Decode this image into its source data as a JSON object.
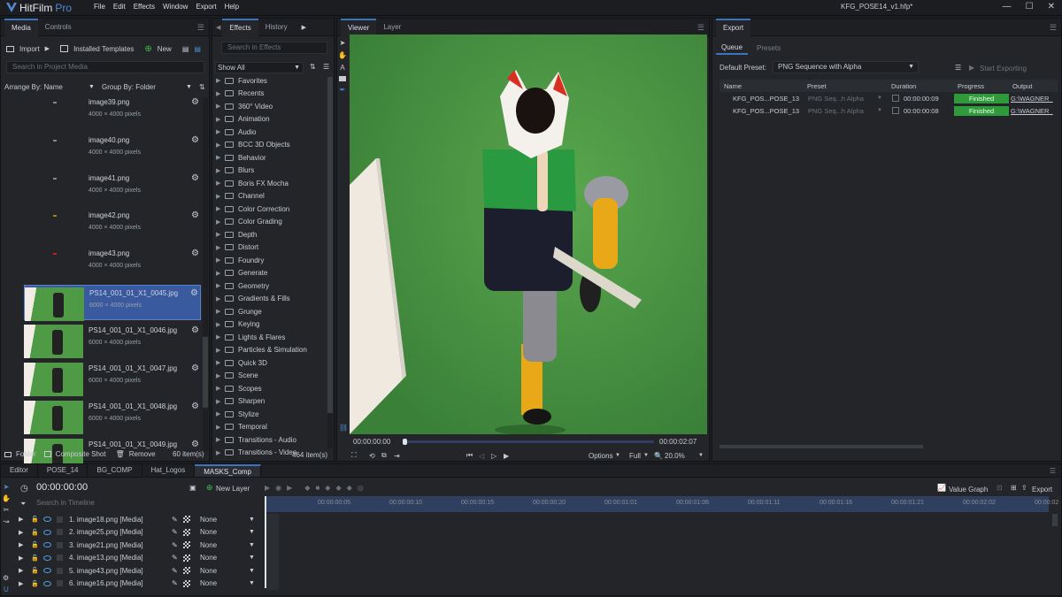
{
  "app": {
    "name": "HitFilm",
    "edition": "Pro",
    "document": "KFG_POSE14_v1.hfp*",
    "menus": [
      "File",
      "Edit",
      "Effects",
      "Window",
      "Export",
      "Help"
    ]
  },
  "colors": {
    "accent": "#3d74c0",
    "finished": "#2f9a3a",
    "greenscreen": "#4f9a45"
  },
  "media": {
    "tabs": [
      "Media",
      "Controls"
    ],
    "import": "Import",
    "installed": "Installed Templates",
    "new": "New",
    "search_placeholder": "Search in Project Media",
    "arrange": "Arrange By: Name",
    "group": "Group By: Folder",
    "items": [
      {
        "name": "image39.png",
        "dim": "4000 × 4000 pixels",
        "thumb": "blank"
      },
      {
        "name": "image40.png",
        "dim": "4000 × 4000 pixels",
        "thumb": "blank"
      },
      {
        "name": "image41.png",
        "dim": "4000 × 4000 pixels",
        "thumb": "blank"
      },
      {
        "name": "image42.png",
        "dim": "4000 × 4000 pixels",
        "thumb": "blank"
      },
      {
        "name": "image43.png",
        "dim": "4000 × 4000 pixels",
        "thumb": "blank"
      },
      {
        "name": "PS14_001_01_X1_0045.jpg",
        "dim": "6000 × 4000 pixels",
        "thumb": "photo",
        "selected": true
      },
      {
        "name": "PS14_001_01_X1_0046.jpg",
        "dim": "6000 × 4000 pixels",
        "thumb": "photo"
      },
      {
        "name": "PS14_001_01_X1_0047.jpg",
        "dim": "6000 × 4000 pixels",
        "thumb": "photo"
      },
      {
        "name": "PS14_001_01_X1_0048.jpg",
        "dim": "6000 × 4000 pixels",
        "thumb": "photo"
      },
      {
        "name": "PS14_001_01_X1_0049.jpg",
        "dim": "",
        "thumb": "photo"
      }
    ],
    "footer": {
      "folder": "Folder",
      "composite": "Composite Shot",
      "remove": "Remove",
      "count": "60 item(s)"
    }
  },
  "effects": {
    "tabs": [
      "Effects",
      "History"
    ],
    "search_placeholder": "Search in Effects",
    "filter": "Show All",
    "count": "464 item(s)",
    "categories": [
      "Favorites",
      "Recents",
      "360° Video",
      "Animation",
      "Audio",
      "BCC 3D Objects",
      "Behavior",
      "Blurs",
      "Boris FX Mocha",
      "Channel",
      "Color Correction",
      "Color Grading",
      "Depth",
      "Distort",
      "Foundry",
      "Generate",
      "Geometry",
      "Gradients & Fills",
      "Grunge",
      "Keying",
      "Lights & Flares",
      "Particles & Simulation",
      "Quick 3D",
      "Scene",
      "Scopes",
      "Sharpen",
      "Stylize",
      "Temporal",
      "Transitions - Audio",
      "Transitions - Video"
    ]
  },
  "viewer": {
    "tabs": [
      "Viewer",
      "Layer"
    ],
    "time_current": "00:00:00:00",
    "time_end": "00:00:02:07",
    "options": "Options",
    "quality": "Full",
    "zoom": "20.0%"
  },
  "export": {
    "title": "Export",
    "tabs": [
      "Queue",
      "Presets"
    ],
    "default_preset_label": "Default Preset:",
    "default_preset": "PNG Sequence with Alpha",
    "start": "Start Exporting",
    "columns": [
      "Name",
      "Preset",
      "Duration",
      "Progress",
      "Output"
    ],
    "rows": [
      {
        "name": "KFG_POS...POSE_13",
        "preset": "PNG Seq...h Alpha",
        "duration": "00:00:00:09",
        "progress": "Finished",
        "output": "G:\\WAGNER_"
      },
      {
        "name": "KFG_POS...POSE_13",
        "preset": "PNG Seq...h Alpha",
        "duration": "00:00:00:08",
        "progress": "Finished",
        "output": "G:\\WAGNER_"
      }
    ]
  },
  "editor": {
    "tabs": [
      "Editor",
      "POSE_14",
      "BG_COMP",
      "Hat_Logos",
      "MASKS_Comp"
    ],
    "timecode": "00:00:00:00",
    "new_layer": "New Layer",
    "search_placeholder": "Search in Timeline",
    "value_graph": "Value Graph",
    "export": "Export",
    "ticks": [
      "00:00:00:05",
      "00:00:00:10",
      "00:00:00:15",
      "00:00:00:20",
      "00:00:01:01",
      "00:00:01:06",
      "00:00:01:11",
      "00:00:01:16",
      "00:00:01:21",
      "00:00:02:02",
      "00:00:02"
    ],
    "layers": [
      {
        "name": "1. image18.png [Media]",
        "blend": "None"
      },
      {
        "name": "2. image25.png [Media]",
        "blend": "None"
      },
      {
        "name": "3. image21.png [Media]",
        "blend": "None"
      },
      {
        "name": "4. image13.png [Media]",
        "blend": "None"
      },
      {
        "name": "5. image43.png [Media]",
        "blend": "None"
      },
      {
        "name": "6. image16.png [Media]",
        "blend": "None"
      }
    ]
  }
}
